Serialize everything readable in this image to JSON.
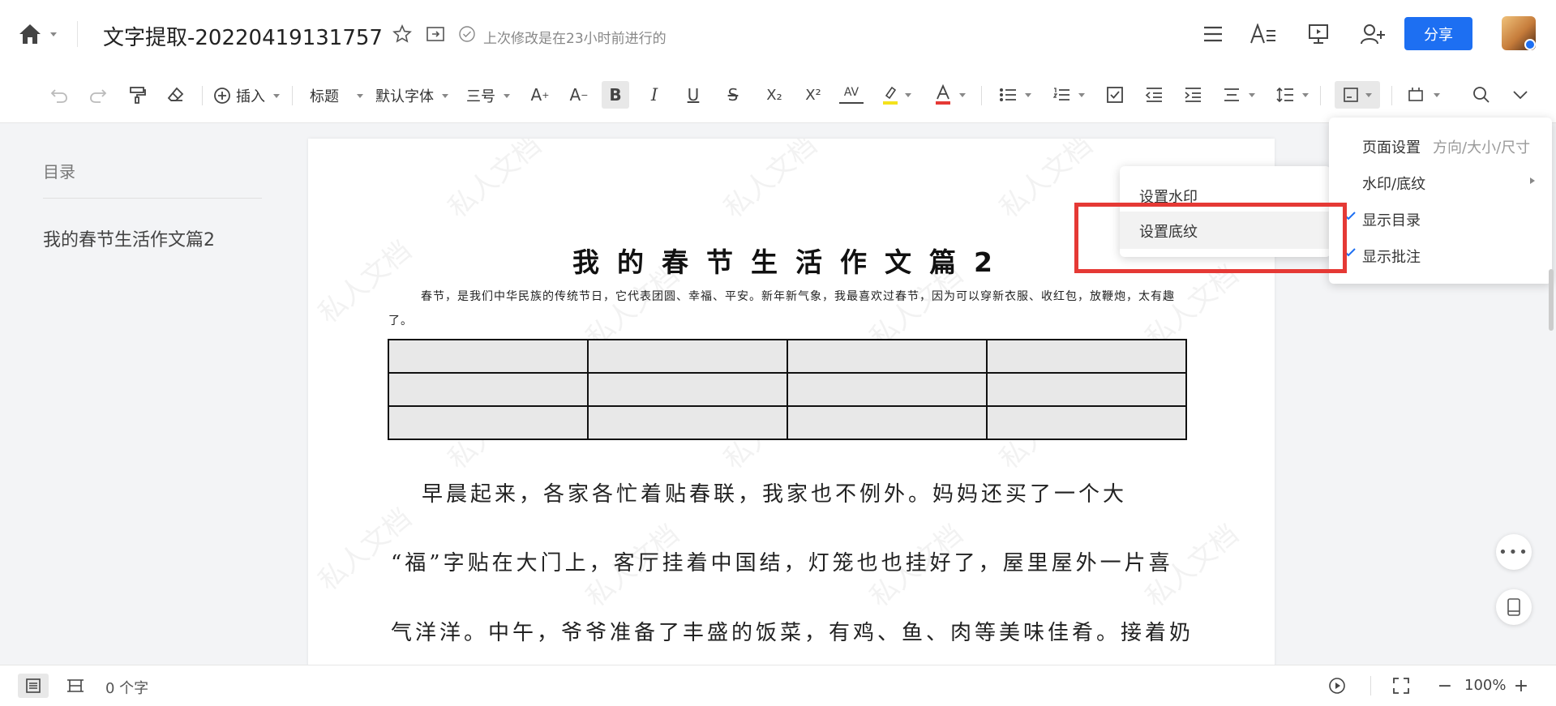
{
  "header": {
    "title": "文字提取-20220419131757",
    "last_modified": "上次修改是在23小时前进行的",
    "share_label": "分享"
  },
  "toolbar": {
    "insert": "插入",
    "heading": "标题",
    "font": "默认字体",
    "size": "三号",
    "sub": "X₂",
    "sup": "X²",
    "av": "AV"
  },
  "sidebar": {
    "title": "目录",
    "items": [
      {
        "label": "我的春节生活作文篇2"
      }
    ]
  },
  "document": {
    "title": "我的春节生活作文篇2",
    "intro": "春节，是我们中华民族的传统节日，它代表团圆、幸福、平安。新年新气象，我最喜欢过春节，因为可以穿新衣服、收红包，放鞭炮，太有趣了。",
    "paragraphs": [
      "早晨起来，各家各忙着贴春联，我家也不例外。妈妈还买了一个大",
      "“福”字贴在大门上，客厅挂着中国结，灯笼也也挂好了，屋里屋外一片喜",
      "气洋洋。中午，爷爷准备了丰盛的饭菜，有鸡、鱼、肉等美味佳肴。接着奶"
    ],
    "watermark": "私人文档"
  },
  "submenu": {
    "items": [
      "设置水印",
      "设置底纹"
    ]
  },
  "page_menu": {
    "page_setup": "页面设置",
    "page_setup_hint": "方向/大小/尺寸",
    "watermark": "水印/底纹",
    "show_toc": "显示目录",
    "show_comments": "显示批注"
  },
  "statusbar": {
    "word_count": "0 个字",
    "zoom": "100%"
  },
  "colors": {
    "accent": "#1d6ff2",
    "highlight": "#e53935"
  }
}
